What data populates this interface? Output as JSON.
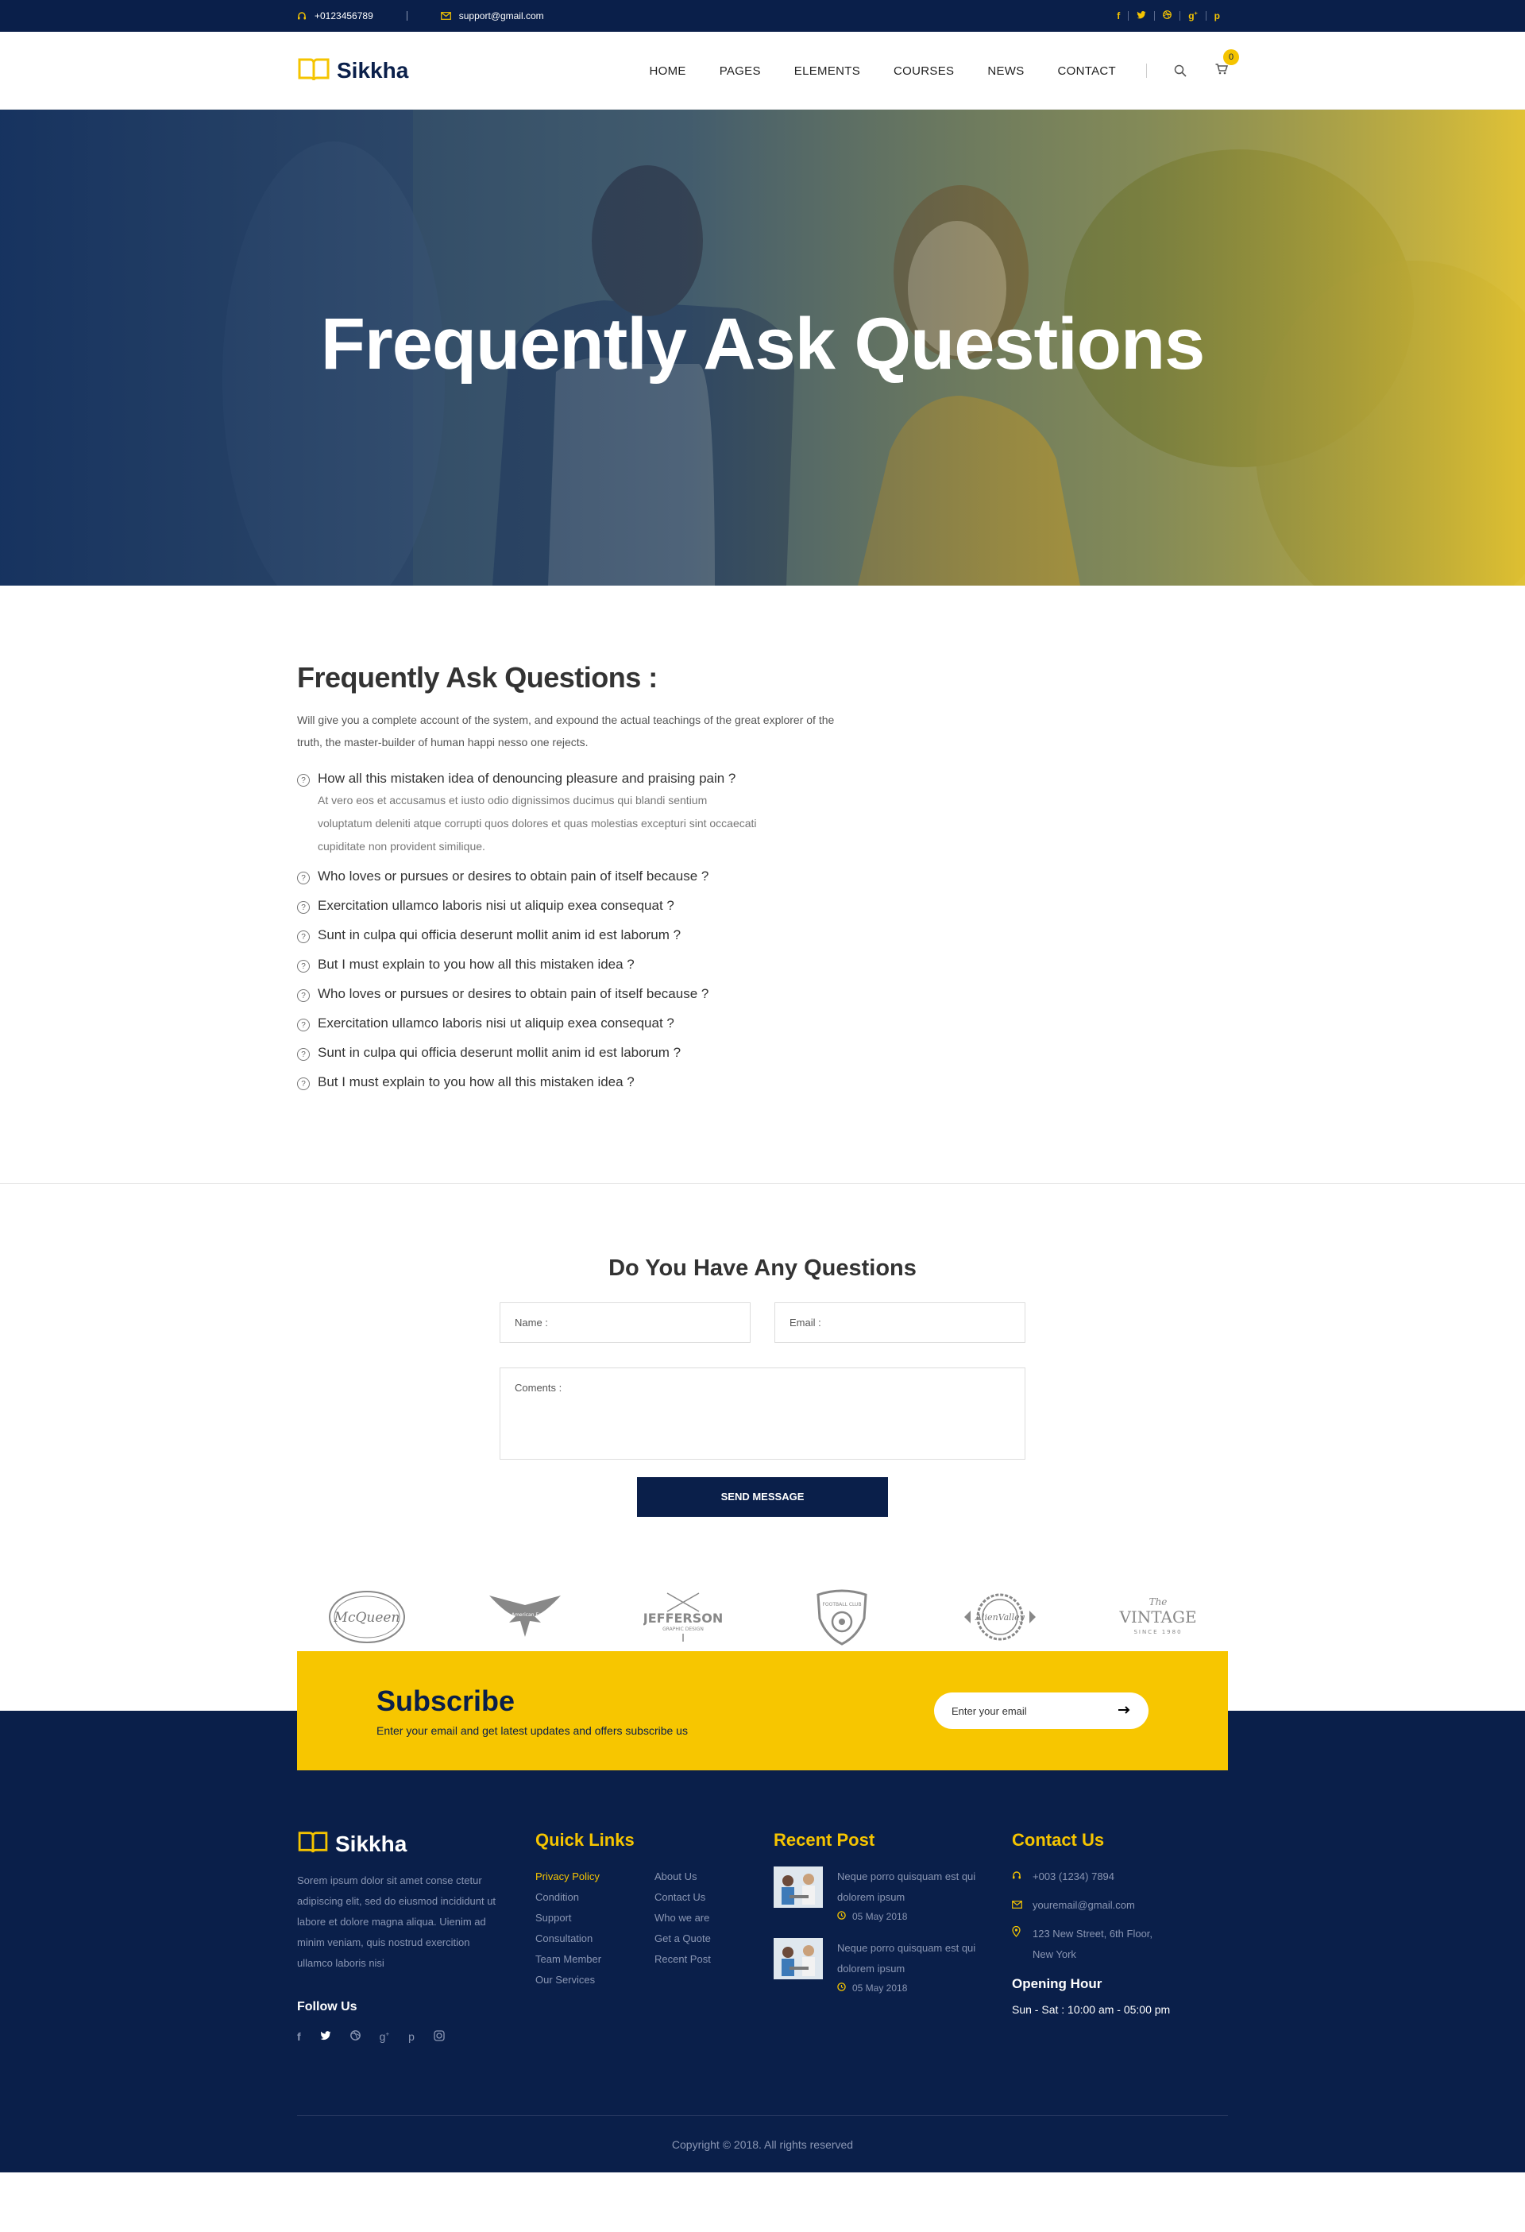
{
  "topbar": {
    "phone": "+0123456789",
    "email": "support@gmail.com",
    "socials": [
      "facebook-icon",
      "twitter-icon",
      "dribbble-icon",
      "google-plus-icon",
      "pinterest-icon"
    ]
  },
  "header": {
    "logo": "Sikkha",
    "nav": [
      "HOME",
      "PAGES",
      "ELEMENTS",
      "COURSES",
      "NEWS",
      "CONTACT"
    ],
    "cart_count": "0"
  },
  "hero": {
    "title": "Frequently Ask Questions"
  },
  "faq": {
    "heading": "Frequently Ask Questions :",
    "intro": "Will give you a complete account of the system, and expound the actual teachings of the great explorer of the truth, the master-builder of human happi nesso one rejects.",
    "items": [
      {
        "q": "How all this mistaken idea of denouncing pleasure and praising pain ?",
        "a": "At vero eos et accusamus et iusto odio dignissimos ducimus qui blandi sentium voluptatum deleniti atque corrupti quos dolores et quas molestias excepturi sint occaecati cupiditate non provident similique."
      },
      {
        "q": "Who loves or pursues or desires to obtain pain of itself because ?"
      },
      {
        "q": "Exercitation ullamco laboris nisi ut aliquip exea  consequat ?"
      },
      {
        "q": "Sunt in culpa qui officia deserunt mollit anim id est laborum ?"
      },
      {
        "q": "But I must explain to you how all this mistaken idea ?"
      },
      {
        "q": "Who loves or pursues or desires to obtain pain of itself because ?"
      },
      {
        "q": "Exercitation ullamco laboris nisi ut aliquip exea  consequat ?"
      },
      {
        "q": "Sunt in culpa qui officia deserunt mollit anim id est laborum ?"
      },
      {
        "q": "But I must explain to you how all this mistaken idea ?"
      }
    ]
  },
  "ask": {
    "heading": "Do You Have Any Questions",
    "name_placeholder": "Name :",
    "email_placeholder": "Email :",
    "comments_placeholder": "Coments :",
    "send": "SEND MESSAGE"
  },
  "brands": {
    "mcqueen": "McQueen",
    "eagle": "The American Eagle",
    "jefferson": "JEFFERSON",
    "jefferson_sub": "GRAPHIC DESIGN",
    "football": "FOOTBALL CLUB",
    "alien": "AlienValley",
    "vintage_the": "The",
    "vintage": "VINTAGE",
    "vintage_sub": "SINCE 1980"
  },
  "subscribe": {
    "title": "Subscribe",
    "text": "Enter  your email and get latest updates and offers subscribe us",
    "placeholder": "Enter your email"
  },
  "footer": {
    "logo": "Sikkha",
    "about": "Sorem ipsum dolor sit amet conse ctetur adipiscing elit, sed do eiusmod  incididunt ut labore et dolore magna aliqua. Uienim ad minim veniam, quis nostrud exercition ullamco laboris nisi",
    "follow": "Follow Us",
    "quick_links_title": "Quick Links",
    "quick_links_a": [
      "Privacy Policy",
      "Condition",
      "Support",
      "Consultation",
      "Team Member",
      "Our Services"
    ],
    "quick_links_b": [
      "About Us",
      "Contact Us",
      "Who we are",
      "Get a Quote",
      "Recent Post"
    ],
    "recent_title": "Recent Post",
    "posts": [
      {
        "title": "Neque porro quisquam est qui dolorem ipsum",
        "date": "05 May 2018"
      },
      {
        "title": "Neque porro quisquam est qui dolorem ipsum",
        "date": "05 May 2018"
      }
    ],
    "contact_title": "Contact Us",
    "phone": "+003 (1234) 7894",
    "email": "youremail@gmail.com",
    "address": "123 New Street, 6th Floor, New York",
    "opening_title": "Opening Hour",
    "opening": "Sun - Sat : 10:00 am - 05:00 pm",
    "copyright": "Copyright © 2018. All rights reserved"
  }
}
